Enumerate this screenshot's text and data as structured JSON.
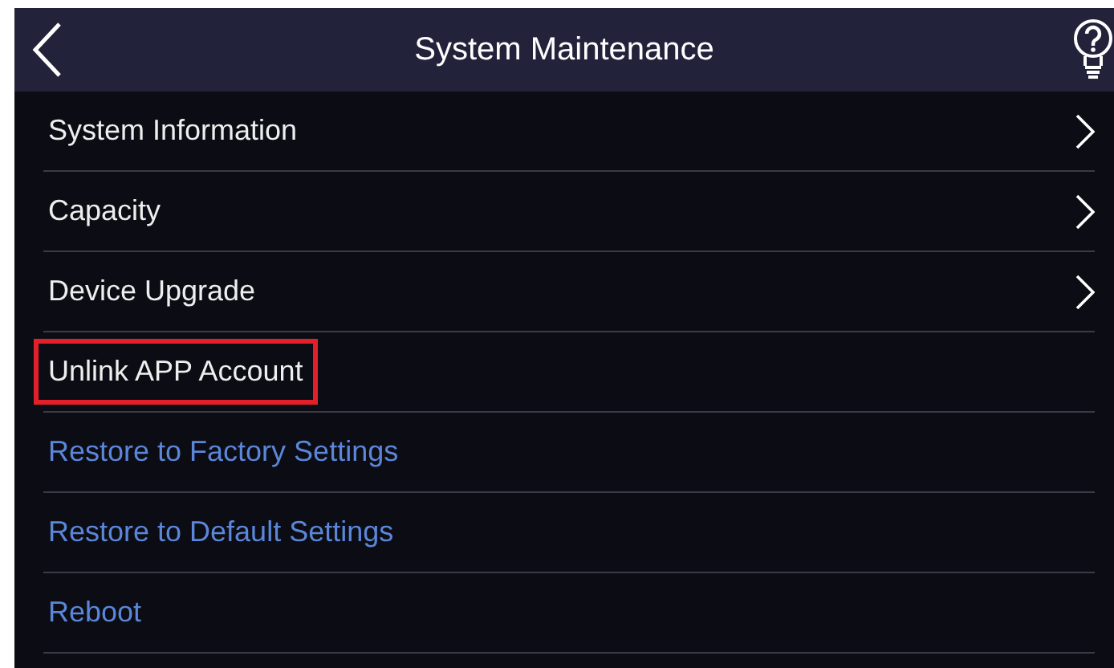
{
  "header": {
    "title": "System Maintenance"
  },
  "items": [
    {
      "label": "System Information",
      "kind": "nav",
      "highlighted": false
    },
    {
      "label": "Capacity",
      "kind": "nav",
      "highlighted": false
    },
    {
      "label": "Device Upgrade",
      "kind": "nav",
      "highlighted": false
    },
    {
      "label": "Unlink APP Account",
      "kind": "plain",
      "highlighted": true
    },
    {
      "label": "Restore to Factory Settings",
      "kind": "action",
      "highlighted": false
    },
    {
      "label": "Restore to Default Settings",
      "kind": "action",
      "highlighted": false
    },
    {
      "label": "Reboot",
      "kind": "action",
      "highlighted": false
    }
  ]
}
